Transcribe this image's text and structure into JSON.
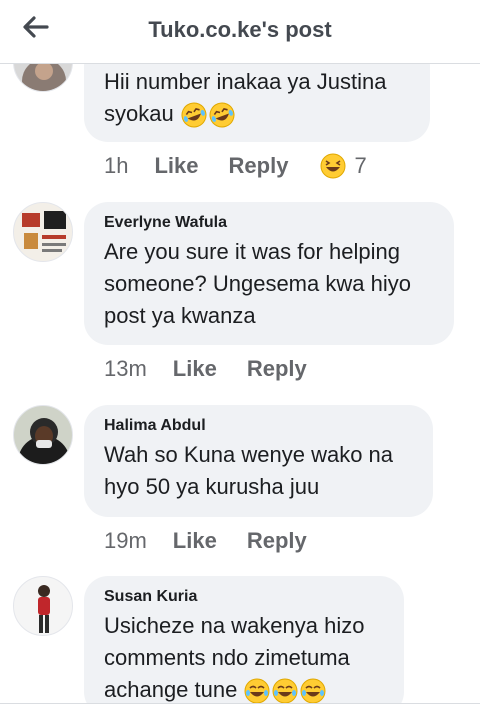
{
  "header": {
    "title": "Tuko.co.ke's post"
  },
  "comments": [
    {
      "author": "",
      "text": "Hii number inakaa ya Justina syokau",
      "emoji": [
        "rolling-on-floor-laughing",
        "rolling-on-floor-laughing"
      ],
      "time": "1h",
      "like_label": "Like",
      "reply_label": "Reply",
      "reaction_count": "7",
      "reaction_emoji": "grinning-squinting"
    },
    {
      "author": "Everlyne Wafula",
      "text": "Are you sure it was for helping someone? Ungesema kwa hiyo post ya kwanza",
      "time": "13m",
      "like_label": "Like",
      "reply_label": "Reply"
    },
    {
      "author": "Halima Abdul",
      "text": "Wah so Kuna wenye wako na hyo 50 ya kurusha juu",
      "time": "19m",
      "like_label": "Like",
      "reply_label": "Reply"
    },
    {
      "author": "Susan Kuria",
      "text": "Usicheze na wakenya hizo comments ndo zimetuma achange tune",
      "emoji": [
        "tears-of-joy",
        "tears-of-joy",
        "tears-of-joy"
      ]
    }
  ],
  "colors": {
    "bubble": "#f0f2f5",
    "meta": "#65676b",
    "emoji": "#ffcc33"
  }
}
